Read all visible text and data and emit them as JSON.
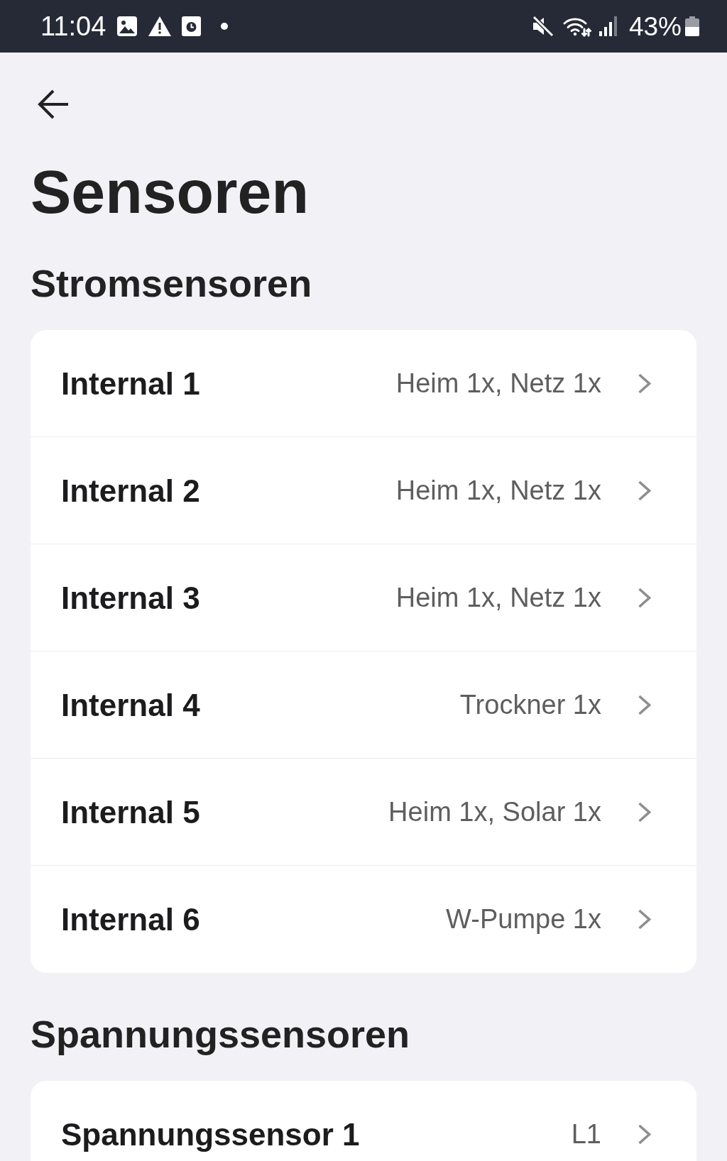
{
  "status_bar": {
    "time": "11:04",
    "battery": "43%"
  },
  "header": {
    "title": "Sensoren"
  },
  "sections": [
    {
      "title": "Stromsensoren",
      "items": [
        {
          "name": "Internal 1",
          "value": "Heim 1x, Netz 1x"
        },
        {
          "name": "Internal 2",
          "value": "Heim 1x, Netz 1x"
        },
        {
          "name": "Internal 3",
          "value": "Heim 1x, Netz 1x"
        },
        {
          "name": "Internal 4",
          "value": "Trockner 1x"
        },
        {
          "name": "Internal 5",
          "value": "Heim 1x, Solar 1x"
        },
        {
          "name": "Internal 6",
          "value": "W-Pumpe 1x"
        }
      ]
    },
    {
      "title": "Spannungssensoren",
      "items": [
        {
          "name": "Spannungssensor 1",
          "value": "L1"
        }
      ]
    }
  ]
}
